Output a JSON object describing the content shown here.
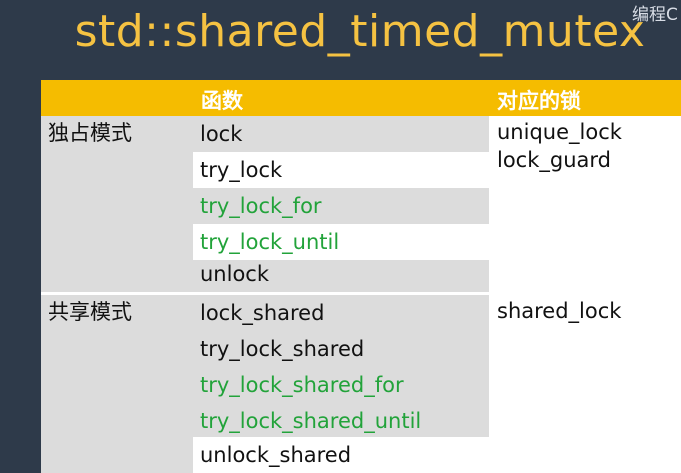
{
  "title": "std::shared_timed_mutex",
  "watermark": "编程C",
  "table": {
    "header": {
      "functions": "函数",
      "locks": "对应的锁"
    },
    "exclusive": {
      "mode": "独占模式",
      "functions": [
        "lock",
        "try_lock",
        "try_lock_for",
        "try_lock_until",
        "unlock"
      ],
      "locks": [
        "unique_lock",
        "lock_guard"
      ]
    },
    "shared": {
      "mode": "共享模式",
      "functions": [
        "lock_shared",
        "try_lock_shared",
        "try_lock_shared_for",
        "try_lock_shared_until",
        "unlock_shared"
      ],
      "locks": [
        "shared_lock"
      ]
    }
  },
  "colors": {
    "title": "#f5c242",
    "header": "#f5bc00",
    "timed_function": "#22a33a",
    "background": "#2e3a4a"
  }
}
